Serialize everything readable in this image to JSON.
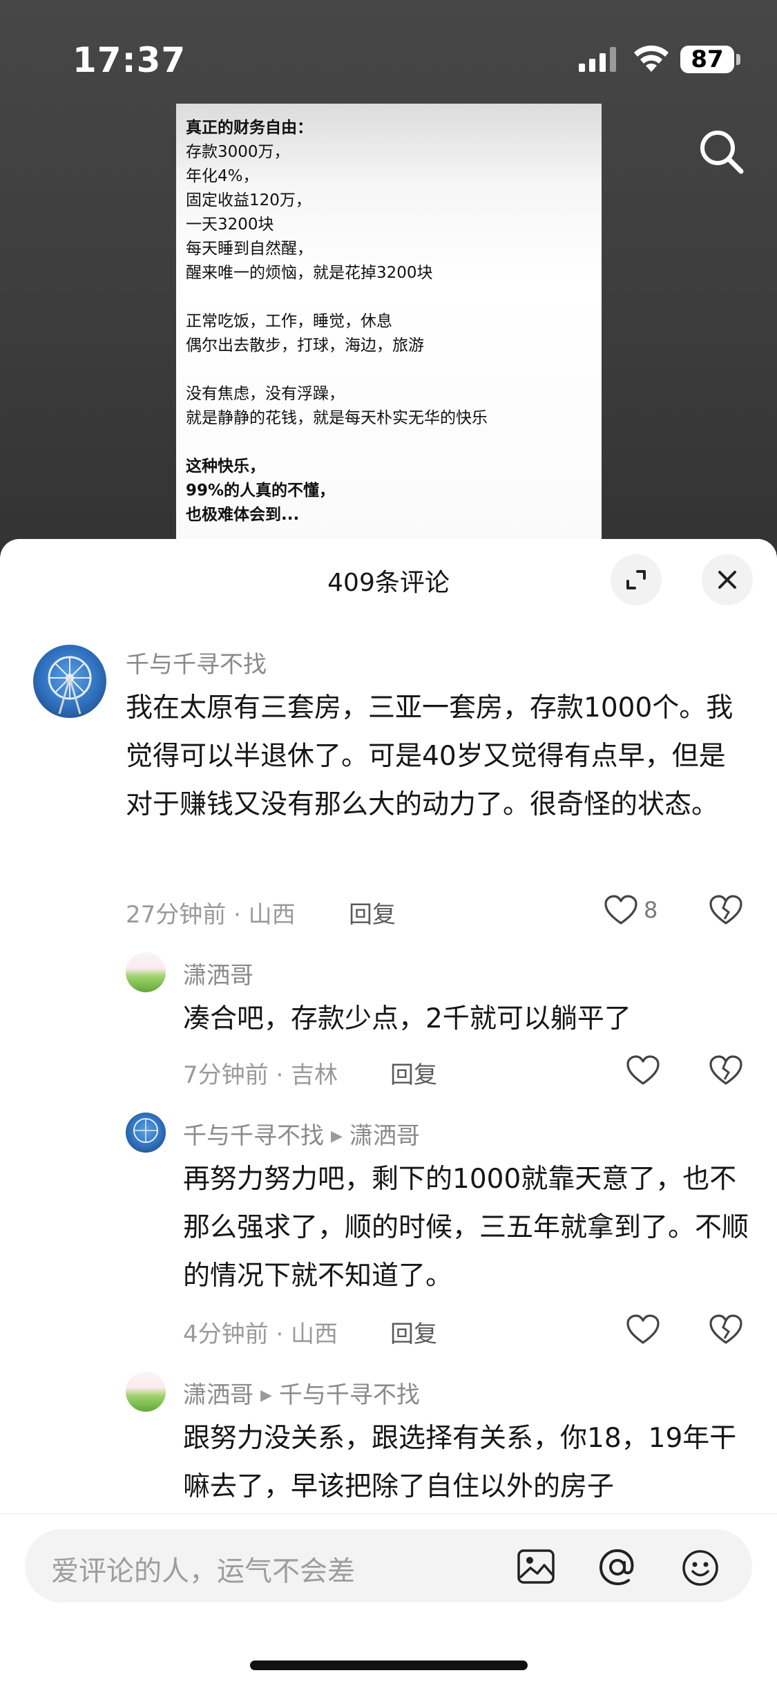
{
  "status_bar": {
    "time": "17:37",
    "battery": "87"
  },
  "post": {
    "lines": [
      {
        "text": "真正的财务自由：",
        "bold": true
      },
      {
        "text": "存款3000万，",
        "bold": false
      },
      {
        "text": "年化4%，",
        "bold": false
      },
      {
        "text": "固定收益120万，",
        "bold": false
      },
      {
        "text": "一天3200块",
        "bold": false
      },
      {
        "text": "每天睡到自然醒，",
        "bold": false
      },
      {
        "text": "醒来唯一的烦恼，就是花掉3200块",
        "bold": false
      },
      {
        "text": "",
        "bold": false
      },
      {
        "text": "正常吃饭，工作，睡觉，休息",
        "bold": false
      },
      {
        "text": "偶尔出去散步，打球，海边，旅游",
        "bold": false
      },
      {
        "text": "",
        "bold": false
      },
      {
        "text": "没有焦虑，没有浮躁，",
        "bold": false
      },
      {
        "text": "就是静静的花钱，就是每天朴实无华的快乐",
        "bold": false
      },
      {
        "text": "",
        "bold": false
      },
      {
        "text": "这种快乐，",
        "bold": true
      },
      {
        "text": "99%的人真的不懂，",
        "bold": true
      },
      {
        "text": "也极难体会到...",
        "bold": true
      }
    ]
  },
  "comments_sheet": {
    "title": "409条评论",
    "comments": [
      {
        "user": "千与千寻不找",
        "text": "我在太原有三套房，三亚一套房，存款1000个。我觉得可以半退休了。可是40岁又觉得有点早，但是对于赚钱又没有那么大的动力了。很奇怪的状态。",
        "meta": "27分钟前 · 山西",
        "reply_label": "回复",
        "likes": "8"
      },
      {
        "user": "潇洒哥",
        "text": "凑合吧，存款少点，2千就可以躺平了",
        "meta": "7分钟前 · 吉林",
        "reply_label": "回复"
      },
      {
        "user": "千与千寻不找",
        "reply_to": "潇洒哥",
        "text": "再努力努力吧，剩下的1000就靠天意了，也不那么强求了，顺的时候，三五年就拿到了。不顺的情况下就不知道了。",
        "meta": "4分钟前 · 山西",
        "reply_label": "回复"
      },
      {
        "user": "潇洒哥",
        "reply_to": "千与千寻不找",
        "text": "跟努力没关系，跟选择有关系，你18，19年干嘛去了，早该把除了自住以外的房子"
      }
    ]
  },
  "input": {
    "placeholder": "爱评论的人，运气不会差"
  }
}
